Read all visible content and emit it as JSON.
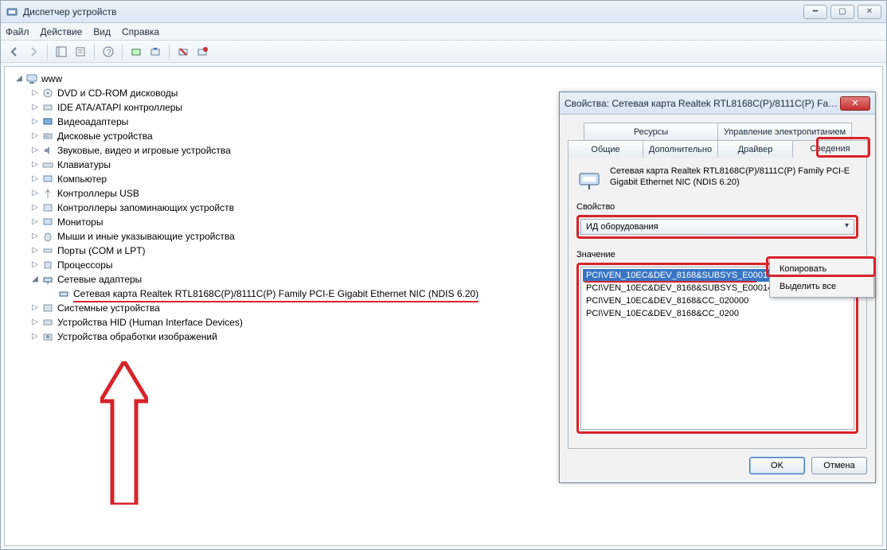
{
  "window": {
    "title": "Диспетчер устройств"
  },
  "menu": {
    "file": "Файл",
    "action": "Действие",
    "view": "Вид",
    "help": "Справка"
  },
  "tree": {
    "root": "www",
    "items": [
      "DVD и CD-ROM дисководы",
      "IDE ATA/ATAPI контроллеры",
      "Видеоадаптеры",
      "Дисковые устройства",
      "Звуковые, видео и игровые устройства",
      "Клавиатуры",
      "Компьютер",
      "Контроллеры USB",
      "Контроллеры запоминающих устройств",
      "Мониторы",
      "Мыши и иные указывающие устройства",
      "Порты (COM и LPT)",
      "Процессоры"
    ],
    "net_adapters": "Сетевые адаптеры",
    "nic": "Сетевая карта Realtek RTL8168C(P)/8111C(P) Family PCI-E Gigabit Ethernet NIC (NDIS 6.20)",
    "tail": [
      "Системные устройства",
      "Устройства HID (Human Interface Devices)",
      "Устройства обработки изображений"
    ]
  },
  "dialog": {
    "title": "Свойства: Сетевая карта Realtek RTL8168C(P)/8111C(P) Family ...",
    "tabs_row1": [
      "Ресурсы",
      "Управление электропитанием"
    ],
    "tabs_row2": [
      "Общие",
      "Дополнительно",
      "Драйвер",
      "Сведения"
    ],
    "device_name_l1": "Сетевая карта Realtek RTL8168C(P)/8111C(P) Family PCI-E",
    "device_name_l2": "Gigabit Ethernet NIC (NDIS 6.20)",
    "prop_label": "Свойство",
    "prop_value": "ИД оборудования",
    "value_label": "Значение",
    "values": [
      "PCI\\VEN_10EC&DEV_8168&SUBSYS_E0001458&REV_02",
      "PCI\\VEN_10EC&DEV_8168&SUBSYS_E0001458",
      "PCI\\VEN_10EC&DEV_8168&CC_020000",
      "PCI\\VEN_10EC&DEV_8168&CC_0200"
    ],
    "ok": "OK",
    "cancel": "Отмена"
  },
  "ctx": {
    "copy": "Копировать",
    "select_all": "Выделить все"
  }
}
